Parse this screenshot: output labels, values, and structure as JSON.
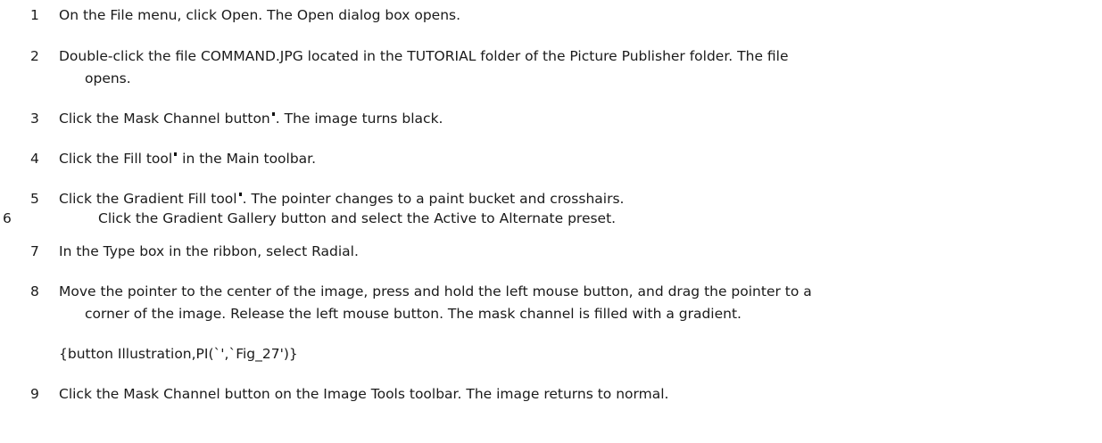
{
  "steps": [
    {
      "num": "1",
      "text": "On the File menu, click Open. The Open dialog box opens."
    },
    {
      "num": "2",
      "line1": "Double-click the file COMMAND.JPG located in the TUTORIAL folder of the Picture Publisher folder. The file",
      "line2": "opens."
    },
    {
      "num": "3",
      "before": "Click the Mask Channel button",
      "after": ". The image turns black."
    },
    {
      "num": "4",
      "before": "Click the Fill tool",
      "after": " in the Main toolbar."
    },
    {
      "num": "5",
      "before": "Click the Gradient Fill tool",
      "after": ". The pointer changes to a paint bucket and crosshairs."
    },
    {
      "num": "6",
      "text": "Click the Gradient Gallery button and select the Active to Alternate preset."
    },
    {
      "num": "7",
      "text": "In the Type box in the ribbon, select Radial."
    },
    {
      "num": "8",
      "line1": "Move the pointer to the center of the image, press and hold the left mouse button, and drag the pointer to a",
      "line2": "corner of the image. Release the left mouse button. The mask channel is filled with a gradient."
    },
    {
      "num": "9",
      "text": "Click the Mask Channel button on the Image Tools toolbar. The image returns to normal."
    }
  ],
  "illustration_macro": "{button Illustration,PI(`',`Fig_27')}",
  "icons": {
    "mask_channel": "mask-channel-button-icon",
    "fill_tool": "fill-tool-icon",
    "gradient_fill": "gradient-fill-tool-icon"
  }
}
